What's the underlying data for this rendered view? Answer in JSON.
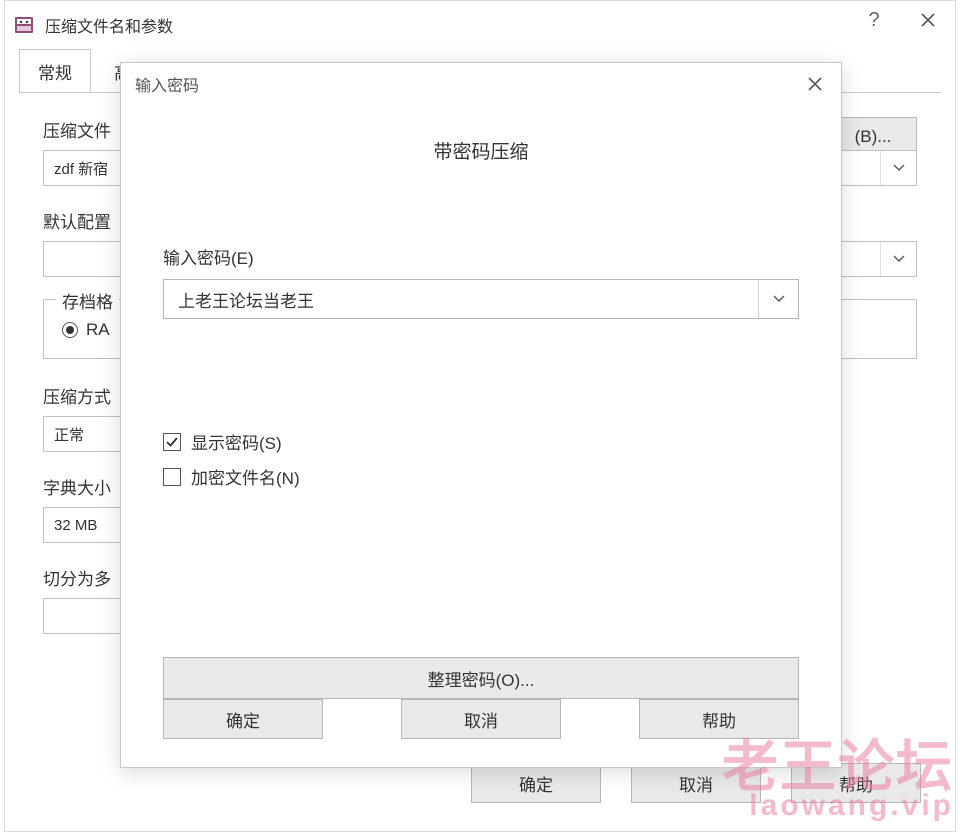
{
  "parent": {
    "title": "压缩文件名和参数",
    "titlebar": {
      "help_glyph": "?"
    },
    "tabs": [
      "常规",
      "高"
    ],
    "archive_name_label": "压缩文件",
    "archive_name_value": "zdf 新宿",
    "browse_label": "(B)...",
    "default_profile_label": "默认配置",
    "archive_format_group_label": "存档格",
    "archive_format_radio": "RA",
    "compression_label": "压缩方式",
    "compression_value": "正常",
    "dict_label": "字典大小",
    "dict_value": "32 MB",
    "split_label": "切分为多",
    "footer": {
      "ok": "确定",
      "cancel": "取消",
      "help": "帮助"
    }
  },
  "modal": {
    "title": "输入密码",
    "heading": "带密码压缩",
    "password_label": "输入密码(E)",
    "password_value": "上老王论坛当老王",
    "show_password_label": "显示密码(S)",
    "show_password_checked": true,
    "encrypt_names_label": "加密文件名(N)",
    "encrypt_names_checked": false,
    "organize_label": "整理密码(O)...",
    "footer": {
      "ok": "确定",
      "cancel": "取消",
      "help": "帮助"
    }
  },
  "watermark": {
    "line1": "老王论坛",
    "line2": "laowang.vip"
  }
}
